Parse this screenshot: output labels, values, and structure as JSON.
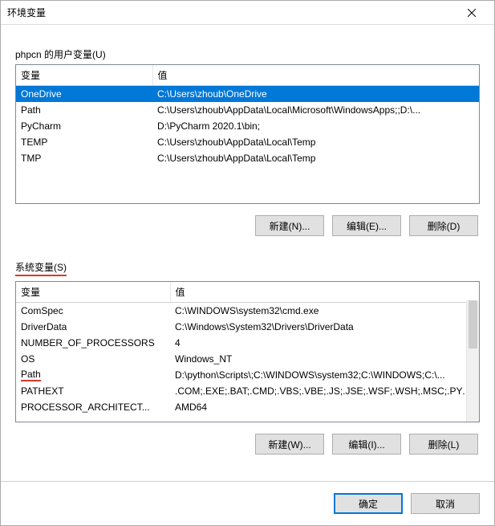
{
  "window": {
    "title": "环境变量"
  },
  "user_section": {
    "label": "phpcn 的用户变量(U)",
    "columns": {
      "var": "变量",
      "val": "值"
    },
    "rows": [
      {
        "var": "OneDrive",
        "val": "C:\\Users\\zhoub\\OneDrive",
        "selected": true
      },
      {
        "var": "Path",
        "val": "C:\\Users\\zhoub\\AppData\\Local\\Microsoft\\WindowsApps;;D:\\...",
        "selected": false
      },
      {
        "var": "PyCharm",
        "val": "D:\\PyCharm 2020.1\\bin;",
        "selected": false
      },
      {
        "var": "TEMP",
        "val": "C:\\Users\\zhoub\\AppData\\Local\\Temp",
        "selected": false
      },
      {
        "var": "TMP",
        "val": "C:\\Users\\zhoub\\AppData\\Local\\Temp",
        "selected": false
      }
    ],
    "buttons": {
      "new": "新建(N)...",
      "edit": "编辑(E)...",
      "delete": "删除(D)"
    }
  },
  "sys_section": {
    "label": "系统变量(S)",
    "columns": {
      "var": "变量",
      "val": "值"
    },
    "rows": [
      {
        "var": "ComSpec",
        "val": "C:\\WINDOWS\\system32\\cmd.exe"
      },
      {
        "var": "DriverData",
        "val": "C:\\Windows\\System32\\Drivers\\DriverData"
      },
      {
        "var": "NUMBER_OF_PROCESSORS",
        "val": "4"
      },
      {
        "var": "OS",
        "val": "Windows_NT"
      },
      {
        "var": "Path",
        "val": "D:\\python\\Scripts\\;C:\\WINDOWS\\system32;C:\\WINDOWS;C:\\...",
        "annotated": true
      },
      {
        "var": "PATHEXT",
        "val": ".COM;.EXE;.BAT;.CMD;.VBS;.VBE;.JS;.JSE;.WSF;.WSH;.MSC;.PY;.P..."
      },
      {
        "var": "PROCESSOR_ARCHITECT...",
        "val": "AMD64"
      }
    ],
    "buttons": {
      "new": "新建(W)...",
      "edit": "编辑(I)...",
      "delete": "删除(L)"
    }
  },
  "dialog_buttons": {
    "ok": "确定",
    "cancel": "取消"
  }
}
